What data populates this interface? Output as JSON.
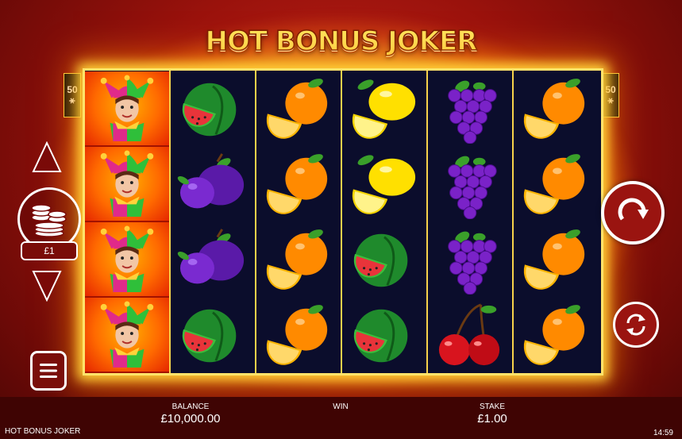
{
  "game": {
    "title": "HOT BONUS JOKER"
  },
  "lines": {
    "left": [
      "50",
      "ⴰ"
    ],
    "right": [
      "50",
      "ⴰ"
    ]
  },
  "left_badge": {
    "top": "50",
    "bottom": "⚹"
  },
  "right_badge": {
    "top": "50",
    "bottom": "⚹"
  },
  "stake_selector": {
    "value": "£1"
  },
  "reels": [
    [
      "joker",
      "joker",
      "joker",
      "joker"
    ],
    [
      "watermelon",
      "plum",
      "plum",
      "watermelon"
    ],
    [
      "orange",
      "orange",
      "orange",
      "orange"
    ],
    [
      "lemon",
      "lemon",
      "watermelon",
      "watermelon"
    ],
    [
      "grapes",
      "grapes",
      "grapes",
      "cherries"
    ],
    [
      "orange",
      "orange",
      "orange",
      "orange"
    ]
  ],
  "footer": {
    "game_name": "HOT BONUS JOKER",
    "balance_label": "BALANCE",
    "balance_value": "£10,000.00",
    "win_label": "WIN",
    "stake_label": "STAKE",
    "stake_value": "£1.00",
    "clock": "14:59"
  },
  "colors": {
    "frame": "#ffe36a",
    "reel_bg": "#0b0d2c",
    "footer_bg": "#3f0403"
  }
}
